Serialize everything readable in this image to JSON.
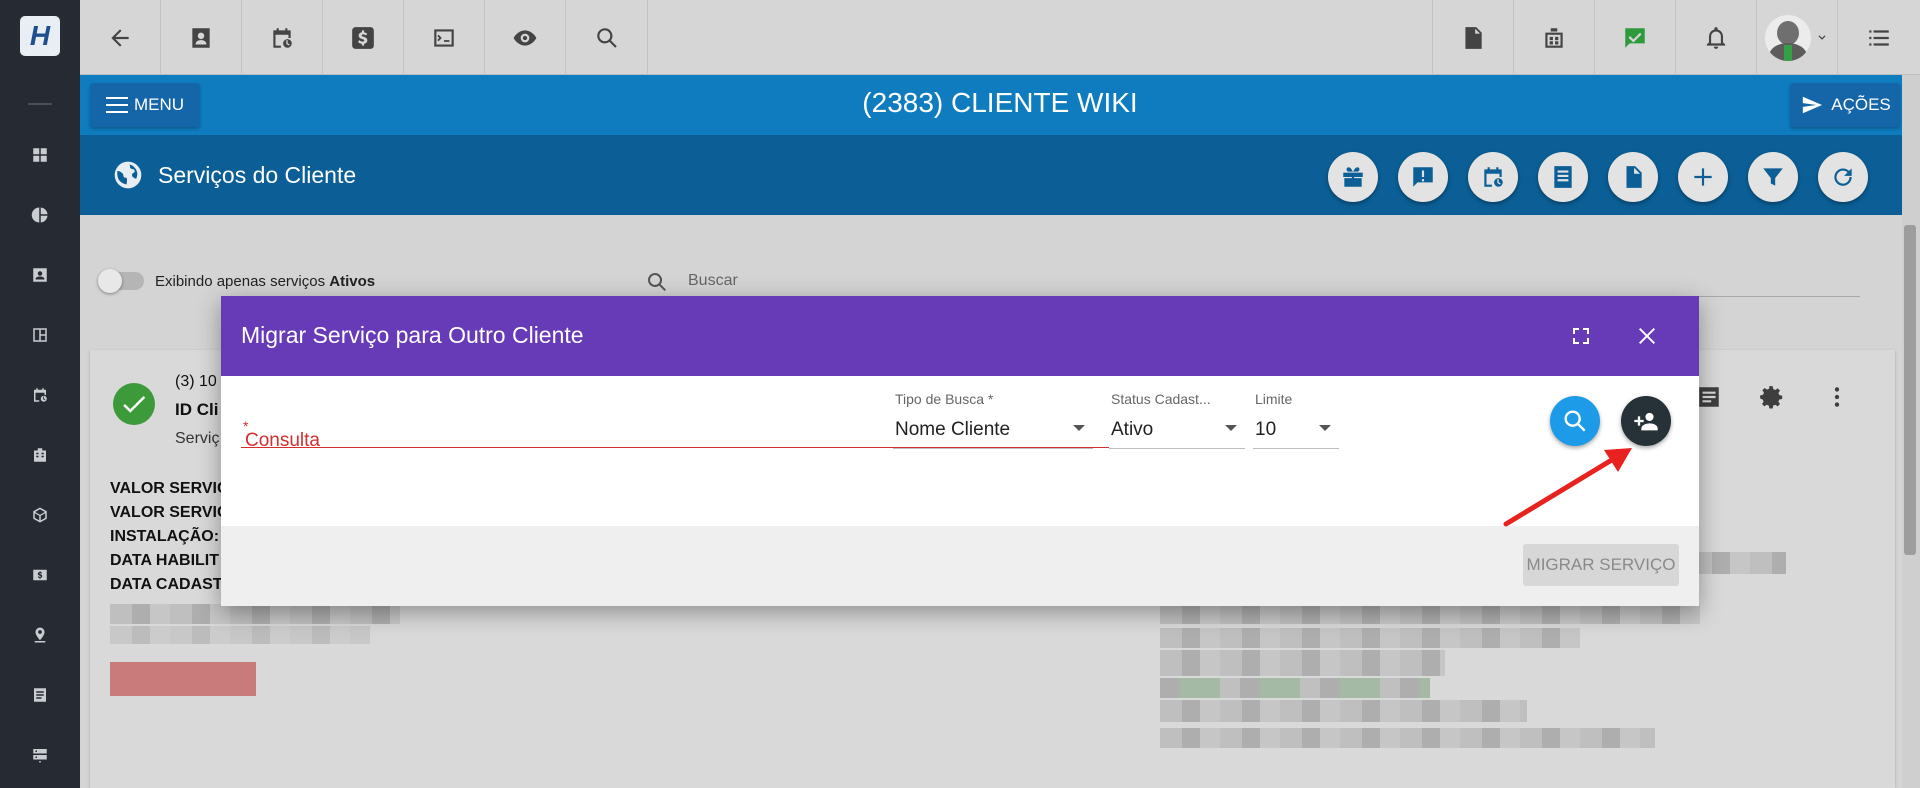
{
  "app": {
    "logo_text": "H"
  },
  "topbar": {
    "icons": [
      "back-arrow-icon",
      "contact-card-icon",
      "calendar-clock-icon",
      "dollar-icon",
      "terminal-icon",
      "eye-icon",
      "search-icon",
      "pdf-icon",
      "building-icon",
      "checked-chat-icon",
      "bell-icon",
      "user-avatar-icon",
      "list-icon"
    ]
  },
  "header": {
    "menu_label": "MENU",
    "client_title": "(2383) CLIENTE WIKI",
    "actions_label": "AÇÕES"
  },
  "section": {
    "title": "Serviços do Cliente",
    "action_icons": [
      "gift-icon",
      "alert-icon",
      "calendar-clock-icon",
      "receipt-icon",
      "file-icon",
      "plus-icon",
      "filter-icon",
      "refresh-icon"
    ]
  },
  "filters": {
    "toggle_label_prefix": "Exibindo apenas serviços",
    "toggle_label_status": "Ativos",
    "search_placeholder": "Buscar"
  },
  "service_card": {
    "id_line": "(3) 10",
    "id_label": "ID Cli",
    "service_label": "Serviç",
    "fields": [
      "VALOR SERVIC",
      "VALOR SERVIC",
      "INSTALAÇÃO:",
      "DATA HABILIT",
      "DATA CADAST"
    ]
  },
  "modal": {
    "title": "Migrar Serviço para Outro Cliente",
    "consulta_label": "Consulta",
    "required_mark": "*",
    "tipo_busca": {
      "label": "Tipo de Busca",
      "required_mark": "*",
      "value": "Nome Cliente"
    },
    "status_cadastro": {
      "label": "Status Cadast...",
      "value": "Ativo"
    },
    "limite": {
      "label": "Limite",
      "value": "10"
    },
    "search_button_icon": "search-icon",
    "add_client_button_icon": "add-person-icon",
    "migrate_button_label": "MIGRAR SERVIÇO"
  },
  "colors": {
    "rail": "#262b33",
    "title_blue": "#0e7cbf",
    "section_blue": "#0b5f96",
    "modal_purple": "#673ab7",
    "error_red": "#d32f2f",
    "search_button": "#1e9be8",
    "add_button": "#263238"
  }
}
